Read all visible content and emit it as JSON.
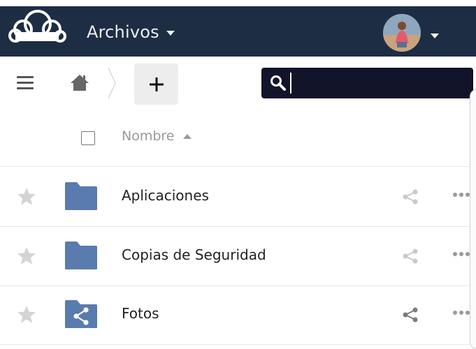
{
  "header": {
    "app_title": "Archivos",
    "logo_icon": "cloud-logo-icon",
    "avatar_icon": "user-avatar",
    "background_color": "#1d2d44"
  },
  "toolbar": {
    "menu_icon": "hamburger-icon",
    "home_icon": "home-icon",
    "new_label": "+",
    "search": {
      "placeholder": "",
      "value": ""
    }
  },
  "file_list": {
    "column_name": "Nombre",
    "sort": "ascending",
    "rows": [
      {
        "name": "Aplicaciones",
        "icon": "folder-icon",
        "shared": false
      },
      {
        "name": "Copias de Seguridad",
        "icon": "folder-icon",
        "shared": false
      },
      {
        "name": "Fotos",
        "icon": "shared-folder-icon",
        "shared": true
      }
    ]
  },
  "colors": {
    "folder": "#5a7bad",
    "search_bg": "#12142a",
    "muted": "#9a9a9a"
  }
}
